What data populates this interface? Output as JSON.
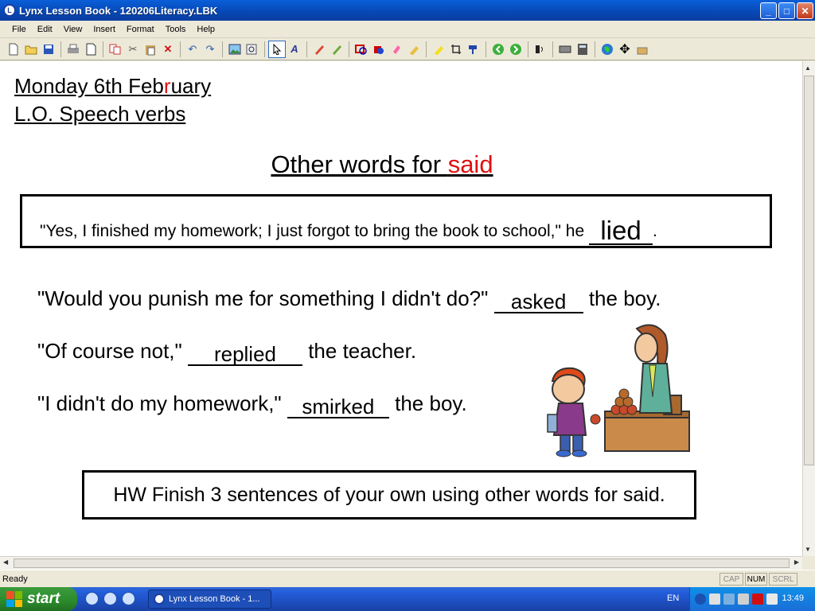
{
  "window": {
    "title": "Lynx Lesson Book - 120206Literacy.LBK",
    "icon": "lynx-logo-icon"
  },
  "menu": [
    "File",
    "Edit",
    "View",
    "Insert",
    "Format",
    "Tools",
    "Help"
  ],
  "toolbar_icons": [
    "new-icon",
    "open-icon",
    "save-icon",
    "print-icon",
    "page-icon",
    "copy-icon",
    "cut-icon",
    "paste-icon",
    "delete-icon",
    "undo-icon",
    "redo-icon",
    "image-icon",
    "zoom-icon",
    "select-icon",
    "text-icon",
    "pen-icon",
    "marker-icon",
    "shape-icon",
    "fill-icon",
    "eraser-icon",
    "highlighter-icon",
    "highlighter-yellow-icon",
    "crop-icon",
    "format-brush-icon",
    "back-icon",
    "forward-icon",
    "presenter-icon",
    "keyboard-icon",
    "calculator-icon",
    "globe-icon",
    "move-icon",
    "tools-icon"
  ],
  "document": {
    "date": {
      "before": "Monday 6th Feb",
      "highlight": "r",
      "after": "uary"
    },
    "objective": "L.O. Speech verbs",
    "heading": {
      "text": "Other words for ",
      "highlight": "said"
    },
    "example": {
      "text": "\"Yes, I finished my homework; I just forgot to bring the book to school,\" he ",
      "answer": "lied",
      "end": "."
    },
    "sentences": [
      {
        "before": "\"Would you punish me for something I didn't do?\" ",
        "answer": "asked",
        "after": " the boy."
      },
      {
        "before": "\"Of course not,\" ",
        "answer": "replied",
        "after": " the teacher."
      },
      {
        "before": "\"I didn't do my homework,\" ",
        "answer": "smirked",
        "after": " the boy."
      }
    ],
    "homework": "HW Finish 3 sentences of your own using other words for said."
  },
  "status": {
    "text": "Ready",
    "indicators": [
      "CAP",
      "NUM",
      "SCRL"
    ]
  },
  "taskbar": {
    "start_label": "start",
    "task_label": "Lynx Lesson Book - 1...",
    "language": "EN",
    "time": "13:49"
  },
  "colors": {
    "accent_red": "#e01010",
    "titlebar": "#0a5fd8"
  }
}
